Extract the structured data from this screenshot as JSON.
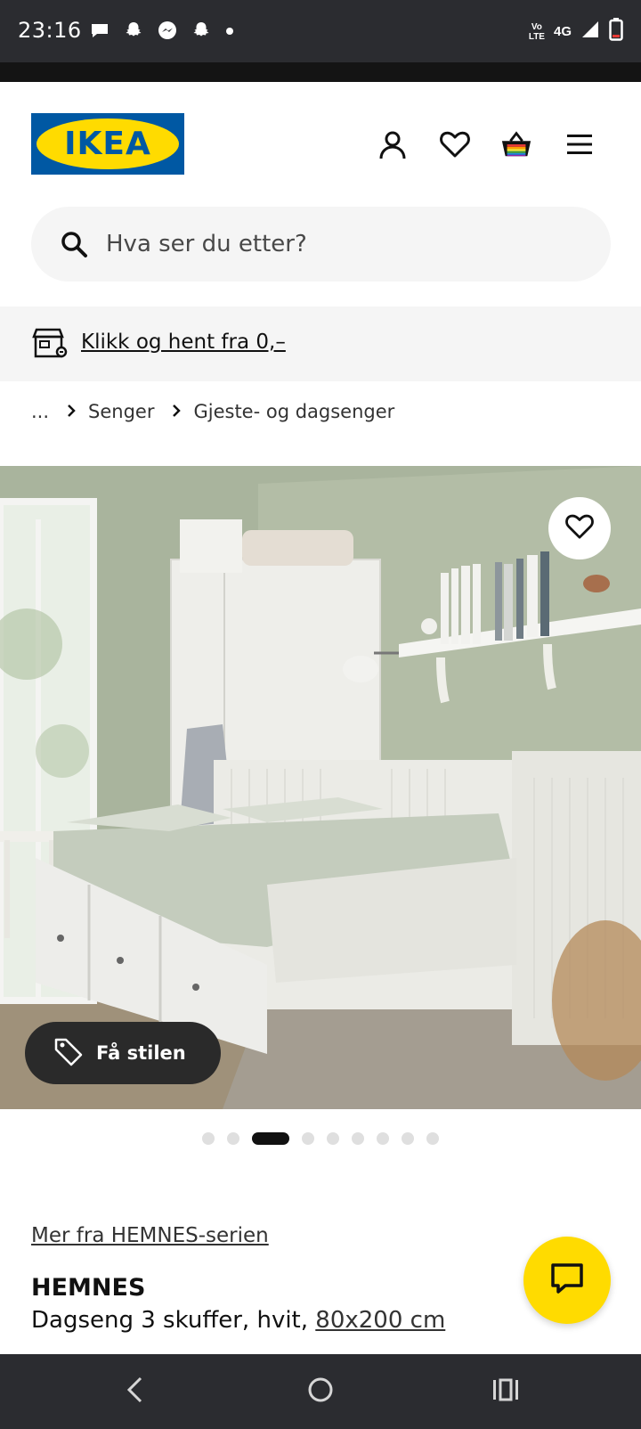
{
  "status_bar": {
    "time": "23:16",
    "volte_line1": "Vo",
    "volte_line2": "LTE",
    "network": "4G",
    "notification_icons": [
      "chat-bubble-icon",
      "snapchat-icon",
      "messenger-icon",
      "snapchat-icon",
      "dot-icon"
    ]
  },
  "header": {
    "logo_text": "IKEA",
    "icons": [
      "account-icon",
      "favourites-icon",
      "shopping-bag-icon",
      "menu-icon"
    ]
  },
  "search": {
    "placeholder": "Hva ser du etter?"
  },
  "promo": {
    "text": "Klikk og hent fra 0,–"
  },
  "breadcrumb": {
    "ellipsis": "...",
    "items": [
      "Senger",
      "Gjeste- og dagsenger"
    ]
  },
  "gallery": {
    "style_button_label": "Få stilen",
    "dot_count": 9,
    "active_dot_index": 2
  },
  "product": {
    "series_link": "Mer fra HEMNES-serien",
    "name": "HEMNES",
    "description": "Dagseng 3 skuffer, hvit, ",
    "size": "80x200 cm"
  },
  "colors": {
    "ikea_blue": "#0058a3",
    "ikea_yellow": "#ffdb00",
    "system_bar": "#2b2c30"
  }
}
